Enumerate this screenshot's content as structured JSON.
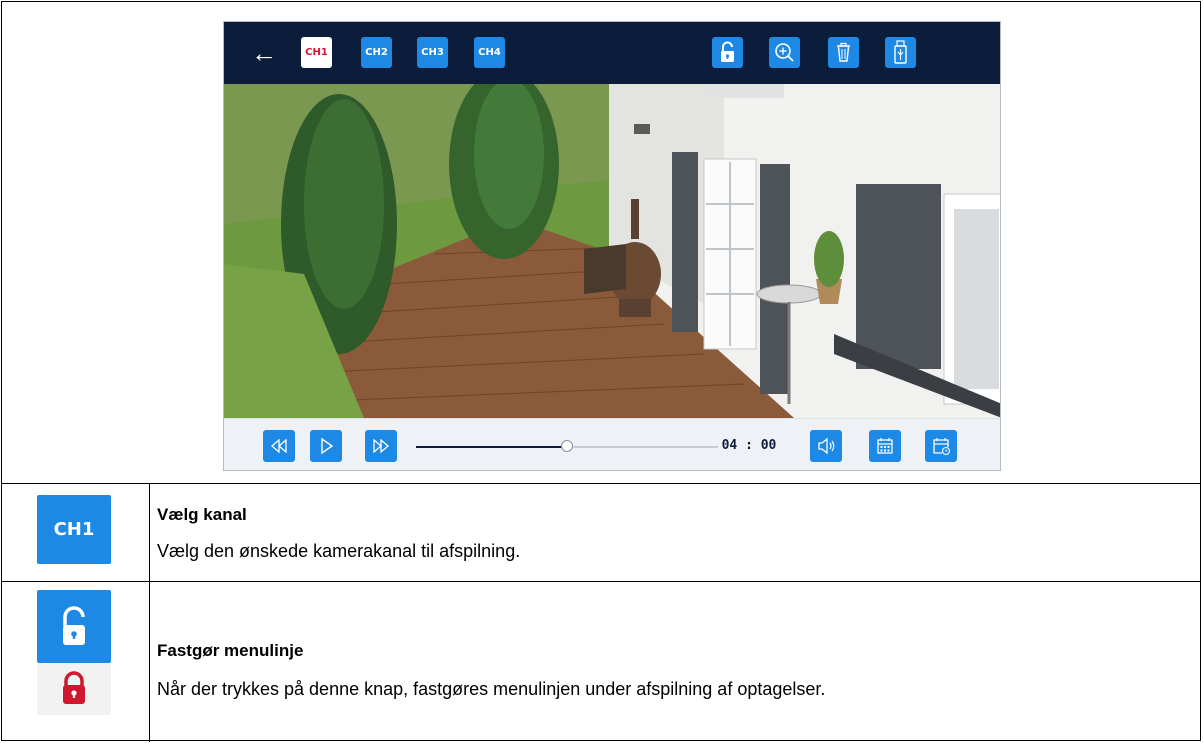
{
  "screen": {
    "toolbar": {
      "back_icon": "arrow-left-icon",
      "channels": [
        "CH1",
        "CH2",
        "CH3",
        "CH4"
      ],
      "active_channel": "CH1",
      "actions": [
        "unlock-icon",
        "zoom-in-icon",
        "trash-icon",
        "usb-icon"
      ]
    },
    "playback": {
      "controls": [
        "rewind-icon",
        "play-icon",
        "fast-forward-icon"
      ],
      "progress": 0.5,
      "time": "04 : 00",
      "right_controls": [
        "volume-icon",
        "calendar-icon",
        "calendar-clock-icon"
      ]
    },
    "colors": {
      "toolbar_bg": "#0b1d3a",
      "button_blue": "#1e88e5",
      "active_channel_text": "#d11730",
      "lock_red": "#d11730"
    }
  },
  "rows": [
    {
      "icon_label": "CH1",
      "title": "Vælg kanal",
      "text": "Vælg den ønskede kamerakanal til afspilning."
    },
    {
      "icons": [
        "unlock-icon",
        "lock-icon"
      ],
      "title": "Fastgør menulinje",
      "text": "Når der trykkes på denne knap, fastgøres menulinjen under afspilning af optagelser."
    }
  ]
}
